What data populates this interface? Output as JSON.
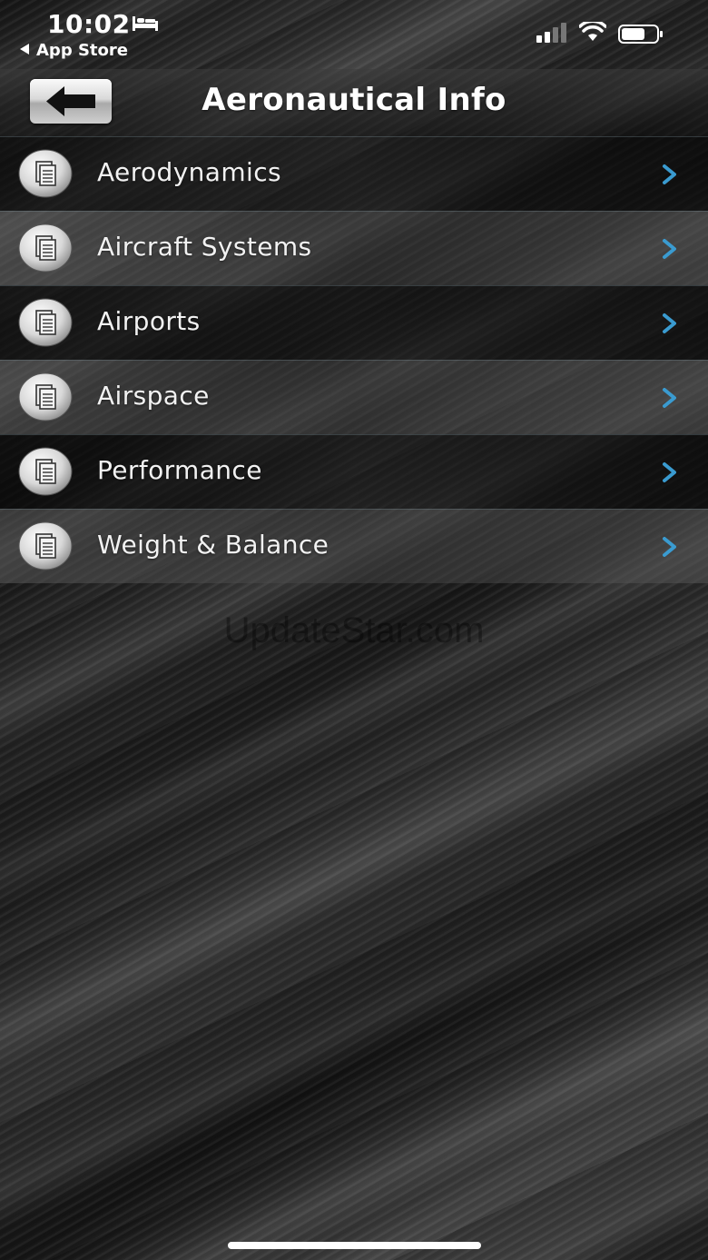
{
  "status_bar": {
    "time": "10:02",
    "back_to_app": "App Store",
    "sleep_icon": "bed-icon",
    "signal_icon": "cellular-signal-icon",
    "wifi_icon": "wifi-icon",
    "battery_icon": "battery-icon"
  },
  "nav": {
    "title": "Aeronautical Info",
    "back_icon": "left-arrow-icon"
  },
  "menu": {
    "items": [
      {
        "label": "Aerodynamics",
        "icon": "document-icon"
      },
      {
        "label": "Aircraft Systems",
        "icon": "document-icon"
      },
      {
        "label": "Airports",
        "icon": "document-icon"
      },
      {
        "label": "Airspace",
        "icon": "document-icon"
      },
      {
        "label": "Performance",
        "icon": "document-icon"
      },
      {
        "label": "Weight & Balance",
        "icon": "document-icon"
      }
    ]
  },
  "watermark": "UpdateStar.com",
  "colors": {
    "chevron": "#3a9bd0",
    "text": "#f2f2f2"
  }
}
